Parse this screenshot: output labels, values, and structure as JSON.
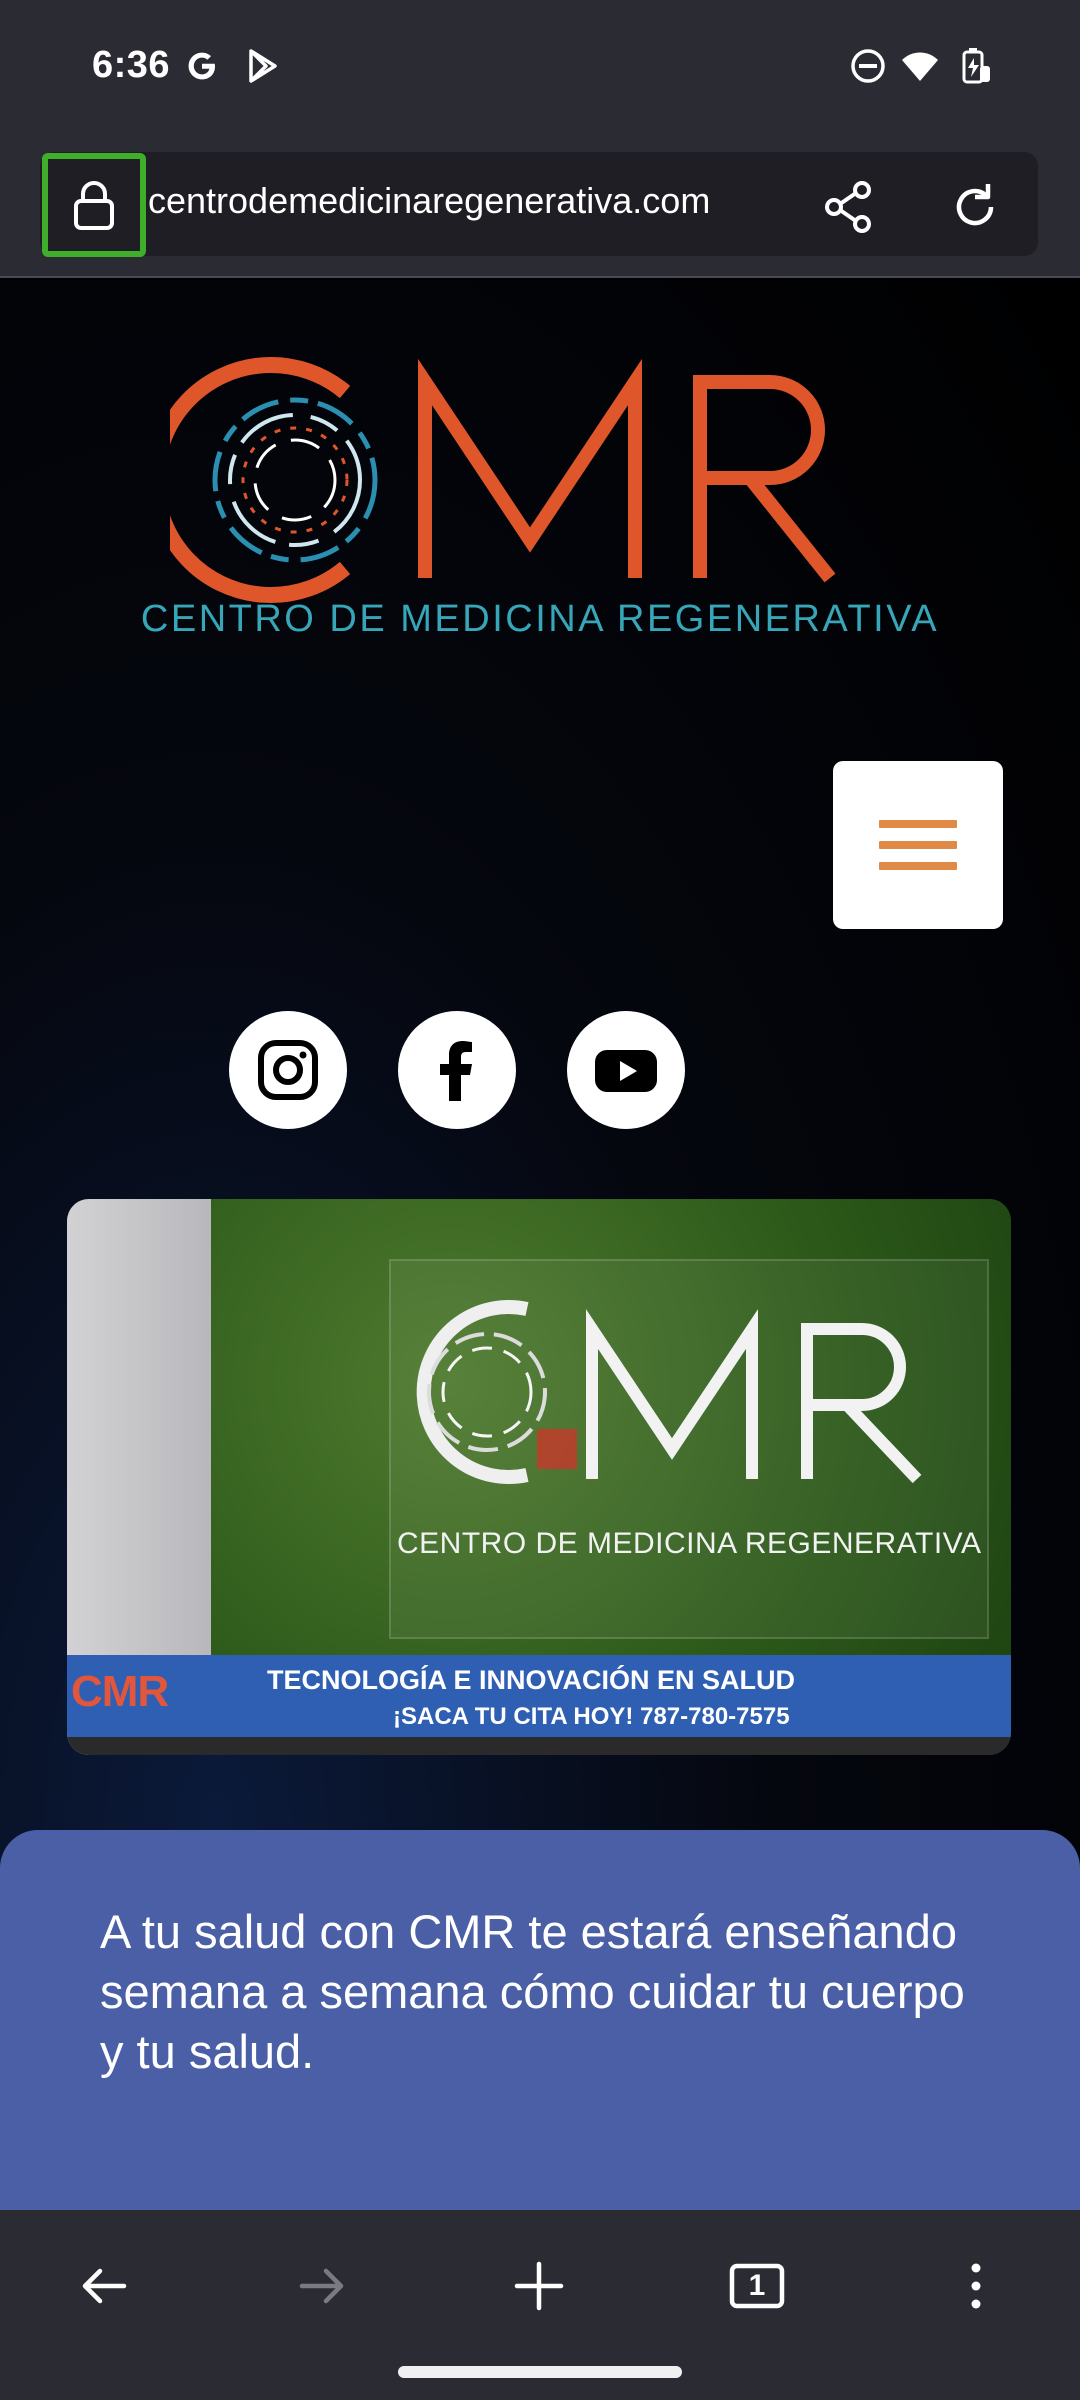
{
  "status_bar": {
    "time": "6:36",
    "left_icons": [
      "google-g-icon",
      "play-store-icon"
    ],
    "right_icons": [
      "do-not-disturb-icon",
      "wifi-icon",
      "battery-charging-icon"
    ]
  },
  "browser": {
    "url": "centrodemedicinaregenerativa.com",
    "security_icon": "lock-icon",
    "actions": [
      "share-icon",
      "reload-icon"
    ]
  },
  "page": {
    "logo_text": "CMR",
    "logo_subtitle": "CENTRO DE MEDICINA REGENERATIVA",
    "menu_icon": "hamburger-menu-icon",
    "social_links": [
      "instagram-icon",
      "facebook-icon",
      "youtube-icon"
    ],
    "banner": {
      "logo_text": "CMR",
      "subtitle": "CENTRO DE MEDICINA REGENERATIVA",
      "strip_logo": "CMR",
      "line1": "TECNOLOGÍA E INNOVACIÓN EN SALUD",
      "line2": "¡SACA TU CITA HOY!  787-780-7575"
    },
    "panel_text": "A tu salud con CMR te estará enseñando semana a semana cómo cuidar tu cuerpo y tu salud."
  },
  "bottom_nav": {
    "tab_count": "1",
    "icons": [
      "back-arrow-icon",
      "forward-arrow-icon",
      "new-tab-plus-icon",
      "tabs-icon",
      "more-options-icon"
    ]
  },
  "colors": {
    "chrome_bg": "#2b2b33",
    "logo_orange": "#e0562b",
    "logo_teal": "#36a6b8",
    "panel_blue": "#4a5fa6",
    "highlight_green": "#3fae2a"
  }
}
